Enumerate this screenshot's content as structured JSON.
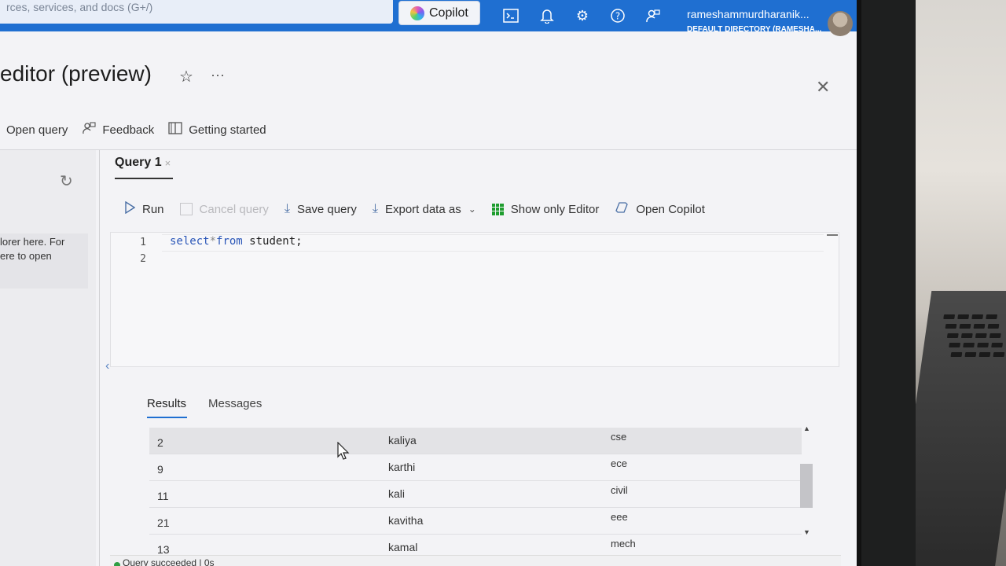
{
  "topbar": {
    "search_placeholder": "rces, services, and docs (G+/)",
    "copilot_label": "Copilot",
    "account_name": "rameshammurdharanik...",
    "account_directory": "DEFAULT DIRECTORY (RAMESHA..."
  },
  "blade": {
    "title": "editor (preview)"
  },
  "commandbar": {
    "open_query": "Open query",
    "feedback": "Feedback",
    "getting_started": "Getting started"
  },
  "explorer": {
    "hint_line1": "lorer here. For",
    "hint_line2": "ere to open"
  },
  "query_tab": {
    "label": "Query 1"
  },
  "editor_toolbar": {
    "run": "Run",
    "cancel_query": "Cancel query",
    "save_query": "Save query",
    "export_data_as": "Export data as",
    "show_only_editor": "Show only Editor",
    "open_copilot": "Open Copilot"
  },
  "editor": {
    "line_numbers": [
      "1",
      "2"
    ],
    "code_kw1": "select",
    "code_op": "*",
    "code_kw2": "from",
    "code_rest": " student;"
  },
  "results": {
    "tabs": [
      "Results",
      "Messages"
    ],
    "rows": [
      [
        "2",
        "kaliya",
        "cse"
      ],
      [
        "9",
        "karthi",
        "ece"
      ],
      [
        "11",
        "kali",
        "civil"
      ],
      [
        "21",
        "kavitha",
        "eee"
      ],
      [
        "13",
        "kamal",
        "mech"
      ]
    ]
  },
  "status": {
    "text": "Query succeeded | 0s"
  },
  "colors": {
    "topbar": "#1f6fd1",
    "accent": "#1f6fd1",
    "success": "#2f9e44"
  }
}
